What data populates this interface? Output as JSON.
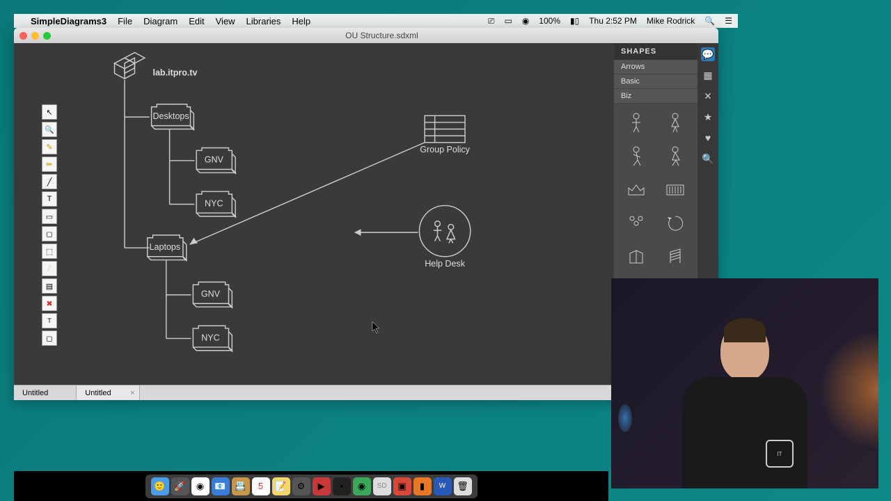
{
  "menubar": {
    "app_name": "SimpleDiagrams3",
    "items": [
      "File",
      "Diagram",
      "Edit",
      "View",
      "Libraries",
      "Help"
    ],
    "battery": "100%",
    "datetime": "Thu 2:52 PM",
    "user": "Mike Rodrick"
  },
  "window": {
    "title": "OU Structure.sdxml"
  },
  "diagram": {
    "root": "lab.itpro.tv",
    "nodes": {
      "desktops": "Desktops",
      "laptops": "Laptops",
      "gnv1": "GNV",
      "nyc1": "NYC",
      "gnv2": "GNV",
      "nyc2": "NYC",
      "group_policy": "Group Policy",
      "help_desk": "Help Desk"
    }
  },
  "shapes_panel": {
    "title": "SHAPES",
    "categories": [
      "Arrows",
      "Basic",
      "Biz"
    ]
  },
  "tabs": [
    "Untitled",
    "Untitled"
  ],
  "tab_add": "+"
}
